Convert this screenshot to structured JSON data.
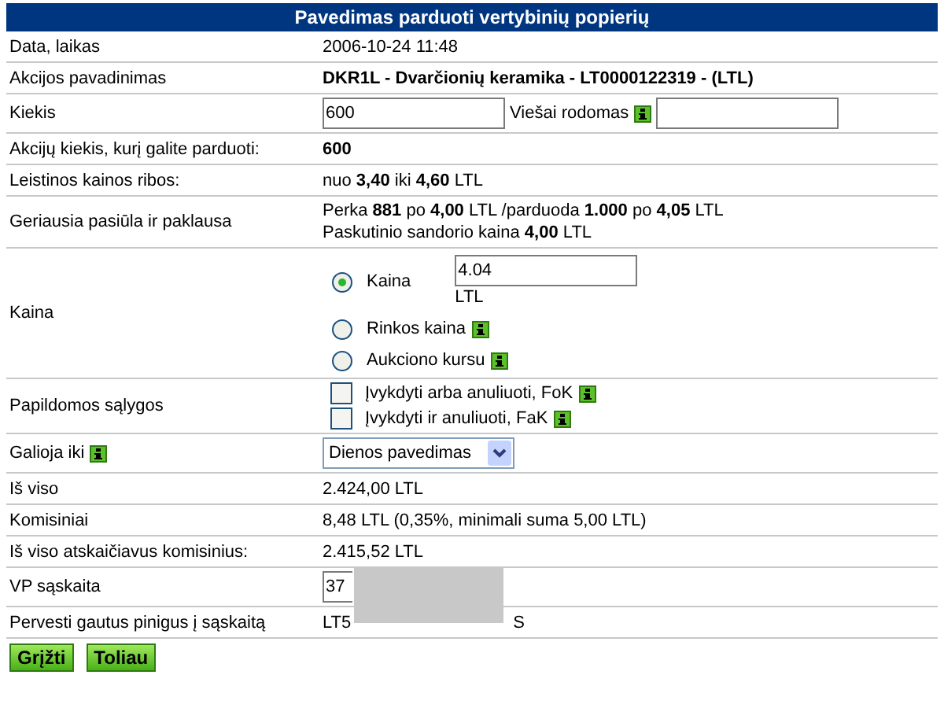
{
  "title": "Pavedimas parduoti vertybinių popierių",
  "rows": [
    {
      "label": "Data, laikas",
      "kind": "text",
      "value": "2006-10-24 11:48"
    },
    {
      "label": "Akcijos pavadinimas",
      "kind": "text",
      "value": "DKR1L - Dvarčionių keramika - LT0000122319 - (LTL)",
      "bold": true
    },
    {
      "label": "Kiekis",
      "kind": "quantity",
      "value": "600",
      "public_label": "Viešai rodomas",
      "public_info": true
    },
    {
      "label": "Akcijų kiekis, kurį galite parduoti:",
      "kind": "text",
      "value": "600",
      "bold": true
    },
    {
      "label": "Leistinos kainos ribos:",
      "kind": "text",
      "value": "nuo **3,40** iki **4,60** LTL"
    },
    {
      "label": "Geriausia pasiūla ir paklausa",
      "kind": "lines",
      "lines": [
        "Perka **881** po **4,00** LTL /parduoda **1.000** po **4,05** LTL",
        "Paskutinio sandorio kaina **4,00** LTL"
      ]
    },
    {
      "label": "Kaina",
      "kind": "radios",
      "options": [
        {
          "label": "Kaina",
          "selected": true,
          "value": "4.04",
          "unit": "LTL"
        },
        {
          "label": "Rinkos kaina",
          "selected": false,
          "info": true
        },
        {
          "label": "Aukciono kursu",
          "selected": false,
          "info": true
        }
      ]
    },
    {
      "label": "Papildomos sąlygos",
      "kind": "checkboxes",
      "options": [
        {
          "label": "Įvykdyti arba anuliuoti, FoK",
          "checked": false,
          "info": true
        },
        {
          "label": "Įvykdyti ir anuliuoti, FaK",
          "checked": false,
          "info": true
        }
      ]
    },
    {
      "label": "Galioja iki",
      "label_info": true,
      "kind": "select",
      "value": "Dienos pavedimas"
    },
    {
      "label": "Iš viso",
      "kind": "text",
      "value": "2.424,00 LTL"
    },
    {
      "label": "Komisiniai",
      "kind": "text",
      "value": "8,48 LTL (0,35%, minimali suma 5,00 LTL)"
    },
    {
      "label": "Iš viso atskaičiavus komisinius:",
      "kind": "text",
      "value": "2.415,52 LTL"
    },
    {
      "label": "VP sąskaita",
      "kind": "input",
      "value": "37",
      "redacted": true
    },
    {
      "label": "Pervesti gautus pinigus į sąskaitą",
      "kind": "masked",
      "start": "LT5",
      "end": "S"
    }
  ],
  "buttons": [
    "Grįžti",
    "Toliau"
  ]
}
